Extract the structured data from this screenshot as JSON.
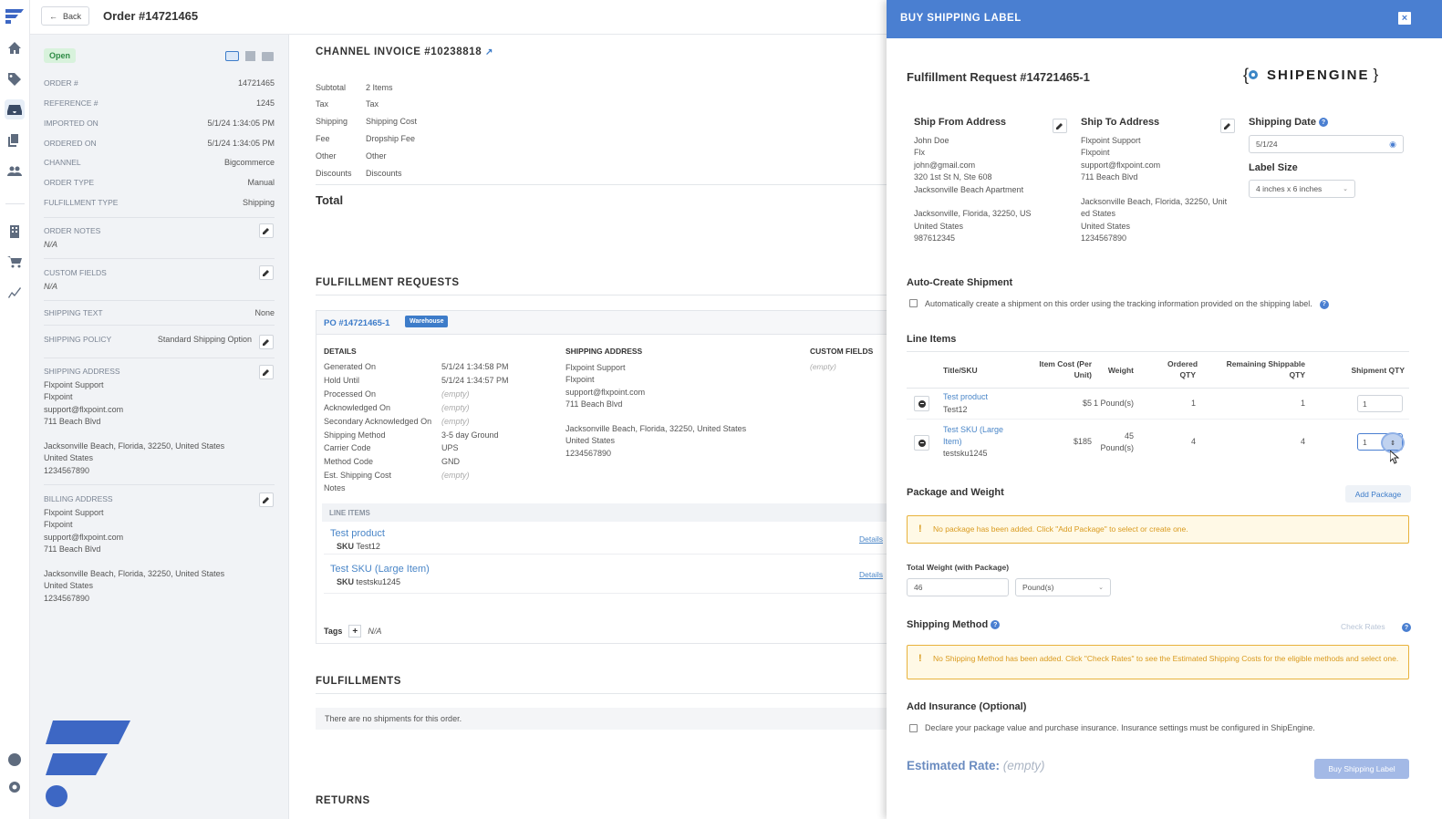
{
  "topbar": {
    "back_label": "Back",
    "order_title": "Order #14721465"
  },
  "left_panel": {
    "status_badge": "Open",
    "fields": [
      {
        "label": "ORDER #",
        "value": "14721465"
      },
      {
        "label": "REFERENCE #",
        "value": "1245"
      },
      {
        "label": "IMPORTED ON",
        "value": "5/1/24 1:34:05 PM"
      },
      {
        "label": "ORDERED ON",
        "value": "5/1/24 1:34:05 PM"
      },
      {
        "label": "CHANNEL",
        "value": "Bigcommerce"
      },
      {
        "label": "ORDER TYPE",
        "value": "Manual"
      },
      {
        "label": "FULFILLMENT TYPE",
        "value": "Shipping"
      }
    ],
    "order_notes_label": "ORDER NOTES",
    "order_notes_value": "N/A",
    "custom_fields_label": "CUSTOM FIELDS",
    "custom_fields_value": "N/A",
    "shipping_text_label": "SHIPPING TEXT",
    "shipping_text_value": "None",
    "shipping_policy_label": "SHIPPING POLICY",
    "shipping_policy_value": "Standard Shipping Option",
    "shipping_address_label": "SHIPPING ADDRESS",
    "shipping_address_lines": [
      "Flxpoint Support",
      "Flxpoint",
      "support@flxpoint.com",
      "711 Beach Blvd",
      "",
      "Jacksonville Beach, Florida, 32250, United States",
      "United States",
      "1234567890"
    ],
    "billing_address_label": "BILLING ADDRESS",
    "billing_address_lines": [
      "Flxpoint Support",
      "Flxpoint",
      "support@flxpoint.com",
      "711 Beach Blvd",
      "",
      "Jacksonville Beach, Florida, 32250, United States",
      "United States",
      "1234567890"
    ]
  },
  "invoice": {
    "title": "CHANNEL INVOICE #10238818",
    "rows": [
      {
        "label": "Subtotal",
        "value": "2 Items"
      },
      {
        "label": "Tax",
        "value": "Tax"
      },
      {
        "label": "Shipping",
        "value": "Shipping Cost"
      },
      {
        "label": "Fee",
        "value": "Dropship Fee"
      },
      {
        "label": "Other",
        "value": "Other"
      },
      {
        "label": "Discounts",
        "value": "Discounts"
      }
    ],
    "total_label": "Total"
  },
  "fulfillment_requests": {
    "section_title": "FULFILLMENT REQUESTS",
    "po_title": "PO #14721465-1",
    "po_badge": "Warehouse",
    "details_head": "DETAILS",
    "shipping_address_head": "SHIPPING ADDRESS",
    "custom_fields_head": "CUSTOM FIELDS",
    "custom_fields_value": "(empty)",
    "details": [
      {
        "label": "Generated On",
        "value": "5/1/24 1:34:58 PM"
      },
      {
        "label": "Hold Until",
        "value": "5/1/24 1:34:57 PM"
      },
      {
        "label": "Processed On",
        "value": "(empty)"
      },
      {
        "label": "Acknowledged On",
        "value": "(empty)"
      },
      {
        "label": "Secondary Acknowledged On",
        "value": "(empty)"
      },
      {
        "label": "Shipping Method",
        "value": "3-5 day Ground"
      },
      {
        "label": "Carrier Code",
        "value": "UPS"
      },
      {
        "label": "Method Code",
        "value": "GND"
      },
      {
        "label": "Est. Shipping Cost",
        "value": "(empty)"
      },
      {
        "label": "Notes",
        "value": ""
      }
    ],
    "shipping_address_lines": [
      "Flxpoint Support",
      "Flxpoint",
      "support@flxpoint.com",
      "711 Beach Blvd",
      "",
      "Jacksonville Beach, Florida, 32250, United States",
      "United States",
      "1234567890"
    ],
    "line_items_head": "LINE ITEMS",
    "line_items": [
      {
        "name": "Test product",
        "sku_label": "SKU",
        "sku": "Test12",
        "details": "Details"
      },
      {
        "name": "Test SKU (Large Item)",
        "sku_label": "SKU",
        "sku": "testsku1245",
        "details": "Details"
      }
    ],
    "tags_label": "Tags",
    "tags_plus": "+",
    "tags_value": "N/A"
  },
  "fulfillments": {
    "title": "FULFILLMENTS",
    "empty_text": "There are no shipments for this order."
  },
  "returns": {
    "title": "RETURNS"
  },
  "drawer": {
    "title": "BUY SHIPPING LABEL",
    "close": "×",
    "request_title": "Fulfillment Request #14721465-1",
    "logo_text": "SHIPENGINE",
    "ship_from_title": "Ship From Address",
    "ship_from_lines": [
      "John Doe",
      "Flx",
      "john@gmail.com",
      "320 1st St N, Ste 608",
      "Jacksonville Beach Apartment",
      "",
      "Jacksonville, Florida, 32250, US",
      "United States",
      "987612345"
    ],
    "ship_to_title": "Ship To Address",
    "ship_to_lines": [
      "Flxpoint Support",
      "Flxpoint",
      "support@flxpoint.com",
      "711 Beach Blvd",
      "",
      "Jacksonville Beach, Florida, 32250, Unit",
      "ed States",
      "United States",
      "1234567890"
    ],
    "shipping_date_title": "Shipping Date",
    "shipping_date_value": "5/1/24",
    "label_size_title": "Label Size",
    "label_size_value": "4 inches x 6 inches",
    "auto_create_title": "Auto-Create Shipment",
    "auto_create_text": "Automatically create a shipment on this order using the tracking information provided on the shipping label.",
    "line_items_title": "Line Items",
    "table_headers": {
      "title_sku": "Title/SKU",
      "item_cost": "Item Cost (Per Unit)",
      "weight": "Weight",
      "ordered": "Ordered QTY",
      "remaining": "Remaining Shippable QTY",
      "shipment": "Shipment QTY"
    },
    "rows": [
      {
        "title": "Test product",
        "sku": "Test12",
        "cost": "$5",
        "weight": "1 Pound(s)",
        "ordered": "1",
        "remaining": "1",
        "qty": "1"
      },
      {
        "title": "Test SKU (Large Item)",
        "sku": "testsku1245",
        "cost": "$185",
        "weight": "45 Pound(s)",
        "ordered": "4",
        "remaining": "4",
        "qty": "1"
      }
    ],
    "package_title": "Package and Weight",
    "add_package": "Add Package",
    "package_warning": "No package has been added. Click \"Add Package\" to select or create one.",
    "total_weight_label": "Total Weight (with Package)",
    "total_weight_value": "46",
    "weight_unit": "Pound(s)",
    "shipping_method_title": "Shipping Method",
    "check_rates": "Check Rates",
    "method_warning": "No Shipping Method has been added. Click \"Check Rates\" to see the Estimated Shipping Costs for the eligible methods and select one.",
    "insurance_title": "Add Insurance (Optional)",
    "insurance_text": "Declare your package value and purchase insurance. Insurance settings must be configured in ShipEngine.",
    "estimated_rate_label": "Estimated Rate:",
    "estimated_rate_value": "(empty)",
    "buy_button": "Buy Shipping Label"
  },
  "colors": {
    "accent": "#4a7fd1",
    "warning": "#e8b23c",
    "open_badge": "#d8f2dc",
    "link": "#3d7cc9"
  }
}
